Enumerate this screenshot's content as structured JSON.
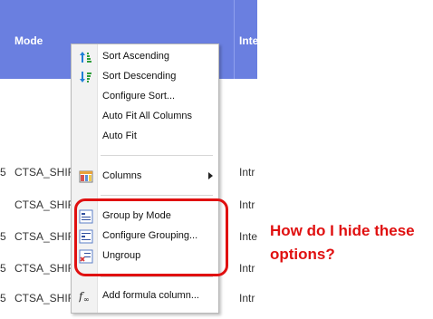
{
  "table": {
    "columns": [
      "Mode",
      "Inte"
    ],
    "rows": [
      {
        "prefix": "5",
        "mode": "CTSA_SHIFT",
        "int": "Intr"
      },
      {
        "prefix": "",
        "mode": "CTSA_SHIFT",
        "int": "Intr"
      },
      {
        "prefix": "5",
        "mode": "CTSA_SHIFT",
        "int": "Inte"
      },
      {
        "prefix": "5",
        "mode": "CTSA_SHIFT",
        "int": "Intr"
      },
      {
        "prefix": "5",
        "mode": "CTSA_SHIFT",
        "int": "Intr"
      },
      {
        "prefix": "5",
        "mode": "CTSA_SHIFT",
        "int": "Inte"
      }
    ]
  },
  "menu": {
    "items": [
      {
        "label": "Sort Ascending",
        "icon": "sort-ascending-icon"
      },
      {
        "label": "Sort Descending",
        "icon": "sort-descending-icon"
      },
      {
        "label": "Configure Sort...",
        "icon": ""
      },
      {
        "label": "Auto Fit All Columns",
        "icon": ""
      },
      {
        "label": "Auto Fit",
        "icon": ""
      },
      {
        "label": "Columns",
        "icon": "columns-icon",
        "submenu": true
      },
      {
        "label": "Group by Mode",
        "icon": "group-icon"
      },
      {
        "label": "Configure Grouping...",
        "icon": "configure-grouping-icon"
      },
      {
        "label": "Ungroup",
        "icon": "ungroup-icon"
      },
      {
        "label": "Add formula column...",
        "icon": "formula-icon"
      }
    ]
  },
  "annotation": {
    "text_line1": "How do I hide these",
    "text_line2": "options?",
    "color": "#e01010"
  }
}
